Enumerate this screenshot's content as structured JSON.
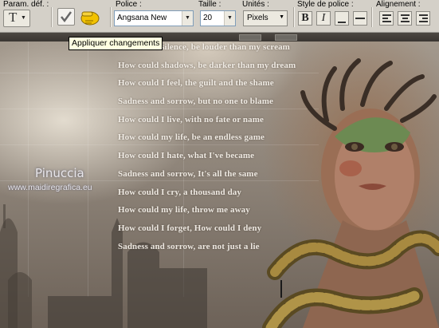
{
  "toolbar": {
    "preset_label": "Param. déf. :",
    "font_label": "Police :",
    "font_value": "Angsana New",
    "size_label": "Taille :",
    "size_value": "20",
    "units_label": "Unités :",
    "units_value": "Pixels",
    "style_label": "Style de police :",
    "align_label": "Alignement :",
    "bold": "B",
    "italic": "I",
    "apply_tooltip": "Appliquer changements"
  },
  "canvas": {
    "poem_lines": [
      "How could silence, be louder than my scream",
      "How could shadows, be darker than my dream",
      "How could I feel, the guilt and the shame",
      "Sadness and sorrow, but no one to blame",
      "How could I live, with no fate or name",
      "How could my life, be an endless game",
      "How could I hate, what I've became",
      "Sadness and sorrow, It's all the same",
      "How could I cry, a thousand day",
      "How could my life, throw me away",
      "How could I forget, How could I deny",
      "Sadness and sorrow, are not just a lie"
    ],
    "watermark_name": "Pinuccia",
    "watermark_url": "www.maidiregrafica.eu"
  },
  "colors": {
    "toolbar_bg": "#d4d0c8",
    "tooltip_bg": "#ffffe1",
    "poem_text": "#f8f4ee"
  }
}
